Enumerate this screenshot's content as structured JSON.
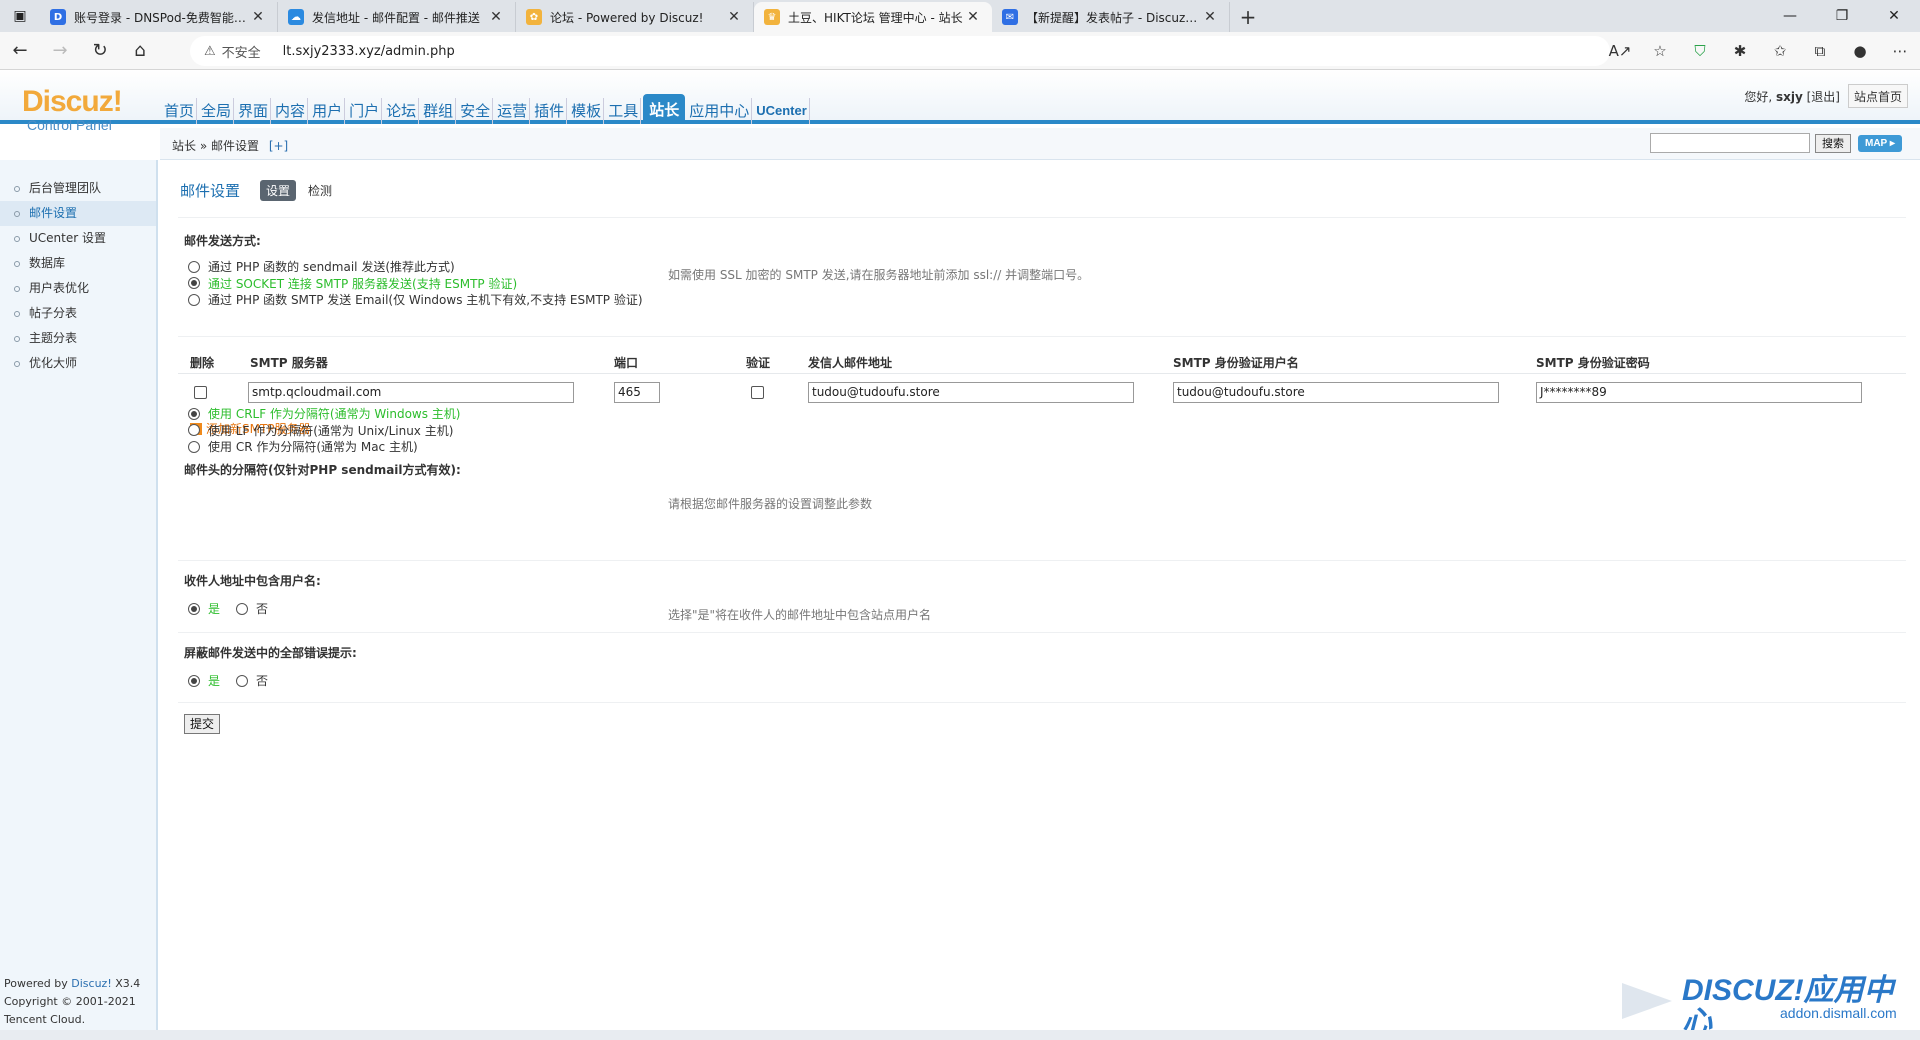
{
  "browser": {
    "tabs": [
      {
        "title": "账号登录 - DNSPod-免费智能DNS",
        "fav_color": "#2f6fe4",
        "fav_glyph": "D"
      },
      {
        "title": "发信地址 - 邮件配置 - 邮件推送",
        "fav_color": "#2b8ae0",
        "fav_glyph": "☁"
      },
      {
        "title": "论坛 - Powered by Discuz!",
        "fav_color": "#f2b33d",
        "fav_glyph": "✿"
      },
      {
        "title": "土豆、HIKT论坛 管理中心 - 站长",
        "fav_color": "#f2b33d",
        "fav_glyph": "♛"
      },
      {
        "title": "【新提醒】发表帖子 - Discuz!教程",
        "fav_color": "#2f6fe4",
        "fav_glyph": "✉"
      }
    ],
    "insecure_label": "不安全",
    "url": "lt.sxjy2333.xyz/admin.php"
  },
  "header": {
    "logo_main": "Discuz!",
    "logo_sub": "Control Panel",
    "nav": [
      "首页",
      "全局",
      "界面",
      "内容",
      "用户",
      "门户",
      "论坛",
      "群组",
      "安全",
      "运营",
      "插件",
      "模板",
      "工具",
      "站长",
      "应用中心",
      "UCenter"
    ],
    "active_nav": "站长",
    "greeting": "您好,",
    "username": "sxjy",
    "logout": "[退出]",
    "site_home": "站点首页"
  },
  "subbar": {
    "breadcrumb": "站长 » 邮件设置",
    "plus": "[+]",
    "search_btn": "搜索",
    "map_btn": "MAP ▸"
  },
  "sidebar": {
    "items": [
      "后台管理团队",
      "邮件设置",
      "UCenter 设置",
      "数据库",
      "用户表优化",
      "帖子分表",
      "主题分表",
      "优化大师"
    ],
    "active": "邮件设置",
    "powered_prefix": "Powered by",
    "powered_brand": "Discuz!",
    "powered_ver": "X3.4",
    "copyright": "Copyright © 2001-2021",
    "company": "Tencent Cloud."
  },
  "content": {
    "title": "邮件设置",
    "tab_set": "设置",
    "tab_check": "检测",
    "send_method": {
      "label": "邮件发送方式:",
      "options": [
        "通过 PHP 函数的 sendmail 发送(推荐此方式)",
        "通过 SOCKET 连接 SMTP 服务器发送(支持 ESMTP 验证)",
        "通过 PHP 函数 SMTP 发送 Email(仅 Windows 主机下有效,不支持 ESMTP 验证)"
      ],
      "selected": 1,
      "tip": "如需使用 SSL 加密的 SMTP 发送,请在服务器地址前添加 ssl:// 并调整端口号。"
    },
    "smtp_table": {
      "headers": [
        "删除",
        "SMTP 服务器",
        "端口",
        "验证",
        "发信人邮件地址",
        "SMTP 身份验证用户名",
        "SMTP 身份验证密码"
      ],
      "row": {
        "server": "smtp.qcloudmail.com",
        "port": "465",
        "from": "tudou@tudoufu.store",
        "user": "tudou@tudoufu.store",
        "password": "J********89"
      },
      "add_label": "添加新SMTP服务器"
    },
    "separator": {
      "label": "邮件头的分隔符(仅针对PHP sendmail方式有效):",
      "options": [
        "使用 CRLF 作为分隔符(通常为 Windows 主机)",
        "使用 LF 作为分隔符(通常为 Unix/Linux 主机)",
        "使用 CR 作为分隔符(通常为 Mac 主机)"
      ],
      "selected": 0,
      "tip": "请根据您邮件服务器的设置调整此参数"
    },
    "include_username": {
      "label": "收件人地址中包含用户名:",
      "yes": "是",
      "no": "否",
      "tip": "选择\"是\"将在收件人的邮件地址中包含站点用户名"
    },
    "silent_errors": {
      "label": "屏蔽邮件发送中的全部错误提示:",
      "yes": "是",
      "no": "否"
    },
    "submit": "提交"
  },
  "watermark": {
    "brand": "DISCUZ!应用中心",
    "sub": "addon.dismall.com"
  }
}
